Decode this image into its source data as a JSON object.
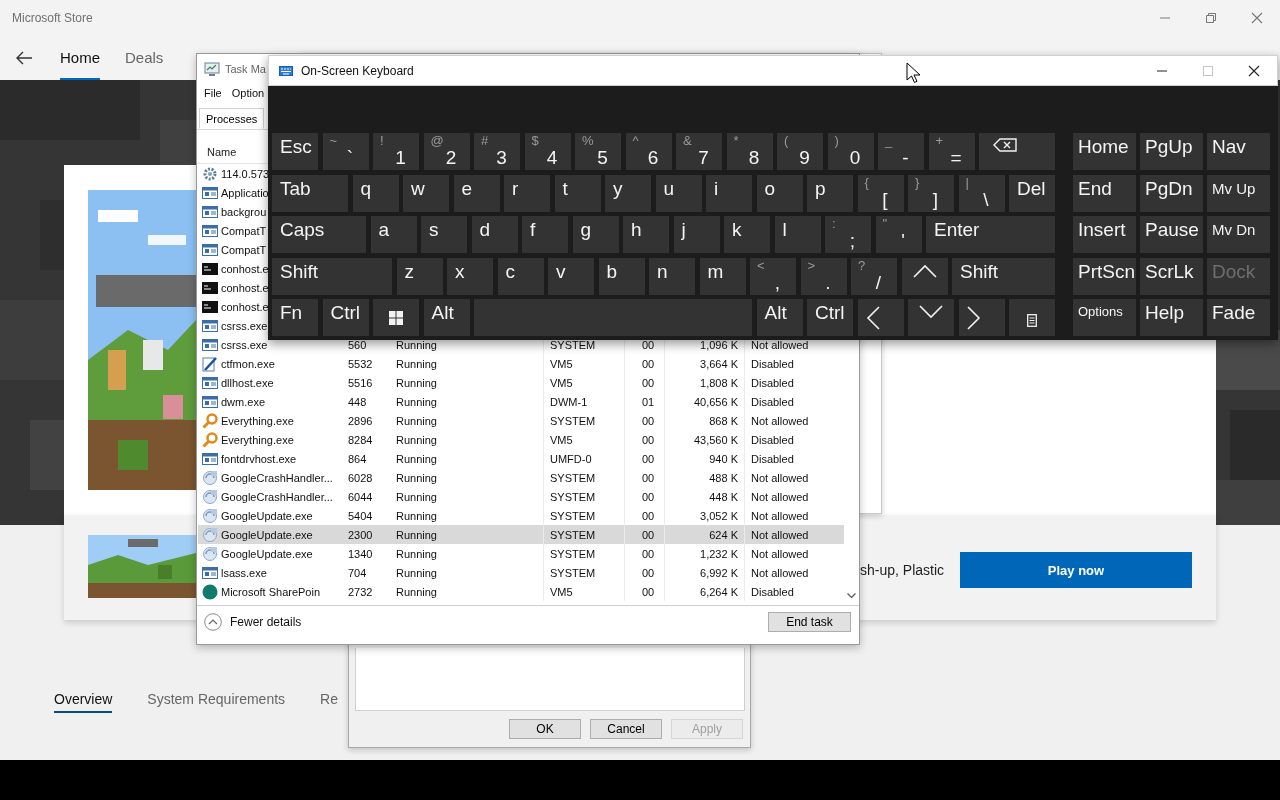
{
  "store": {
    "title": "Microsoft Store",
    "nav_tabs": [
      {
        "label": "Home",
        "selected": true
      },
      {
        "label": "Deals",
        "selected": false
      }
    ],
    "promo": {
      "text": "sh-up, Plastic",
      "button": "Play now"
    },
    "section_tabs": [
      {
        "label": "Overview",
        "selected": true
      },
      {
        "label": "System Requirements",
        "selected": false
      },
      {
        "label": "Re",
        "selected": false
      }
    ]
  },
  "properties_dialog": {
    "buttons": [
      {
        "label": "OK",
        "disabled": false
      },
      {
        "label": "Cancel",
        "disabled": false
      },
      {
        "label": "Apply",
        "disabled": true
      }
    ]
  },
  "task_manager": {
    "title": "Task Ma",
    "menu": [
      "File",
      "Option"
    ],
    "tabs": [
      {
        "label": "Processes",
        "selected": true
      }
    ],
    "name_column": "Name",
    "rows": [
      {
        "kind": "gear",
        "name": "114.0.573",
        "selected": false
      },
      {
        "kind": "window",
        "name": "Applicatio",
        "selected": false
      },
      {
        "kind": "window",
        "name": "backgrou",
        "selected": false
      },
      {
        "kind": "window",
        "name": "CompatT",
        "selected": false
      },
      {
        "kind": "window",
        "name": "CompatT",
        "selected": false
      },
      {
        "kind": "console",
        "name": "conhost.e",
        "selected": false
      },
      {
        "kind": "console",
        "name": "conhost.e",
        "selected": false
      },
      {
        "kind": "console",
        "name": "conhost.e",
        "selected": false
      },
      {
        "kind": "window",
        "name": "csrss.exe",
        "selected": false
      },
      {
        "kind": "window",
        "name": "csrss.exe",
        "pid": "560",
        "status": "Running",
        "user": "SYSTEM",
        "cpu": "00",
        "memory": "1,096 K",
        "uac": "Not allowed",
        "selected": false
      },
      {
        "kind": "pen",
        "name": "ctfmon.exe",
        "pid": "5532",
        "status": "Running",
        "user": "VM5",
        "cpu": "00",
        "memory": "3,664 K",
        "uac": "Disabled",
        "selected": false
      },
      {
        "kind": "window",
        "name": "dllhost.exe",
        "pid": "5516",
        "status": "Running",
        "user": "VM5",
        "cpu": "00",
        "memory": "1,808 K",
        "uac": "Disabled",
        "selected": false
      },
      {
        "kind": "window",
        "name": "dwm.exe",
        "pid": "448",
        "status": "Running",
        "user": "DWM-1",
        "cpu": "01",
        "memory": "40,656 K",
        "uac": "Disabled",
        "selected": false
      },
      {
        "kind": "magnifier",
        "name": "Everything.exe",
        "pid": "2896",
        "status": "Running",
        "user": "SYSTEM",
        "cpu": "00",
        "memory": "868 K",
        "uac": "Not allowed",
        "selected": false
      },
      {
        "kind": "magnifier",
        "name": "Everything.exe",
        "pid": "8284",
        "status": "Running",
        "user": "VM5",
        "cpu": "00",
        "memory": "43,560 K",
        "uac": "Disabled",
        "selected": false
      },
      {
        "kind": "window",
        "name": "fontdrvhost.exe",
        "pid": "864",
        "status": "Running",
        "user": "UMFD-0",
        "cpu": "00",
        "memory": "940 K",
        "uac": "Disabled",
        "selected": false
      },
      {
        "kind": "app",
        "name": "GoogleCrashHandler...",
        "pid": "6028",
        "status": "Running",
        "user": "SYSTEM",
        "cpu": "00",
        "memory": "488 K",
        "uac": "Not allowed",
        "selected": false
      },
      {
        "kind": "app",
        "name": "GoogleCrashHandler...",
        "pid": "6044",
        "status": "Running",
        "user": "SYSTEM",
        "cpu": "00",
        "memory": "448 K",
        "uac": "Not allowed",
        "selected": false
      },
      {
        "kind": "app",
        "name": "GoogleUpdate.exe",
        "pid": "5404",
        "status": "Running",
        "user": "SYSTEM",
        "cpu": "00",
        "memory": "3,052 K",
        "uac": "Not allowed",
        "selected": false
      },
      {
        "kind": "app",
        "name": "GoogleUpdate.exe",
        "pid": "2300",
        "status": "Running",
        "user": "SYSTEM",
        "cpu": "00",
        "memory": "624 K",
        "uac": "Not allowed",
        "selected": true
      },
      {
        "kind": "app",
        "name": "GoogleUpdate.exe",
        "pid": "1340",
        "status": "Running",
        "user": "SYSTEM",
        "cpu": "00",
        "memory": "1,232 K",
        "uac": "Not allowed",
        "selected": false
      },
      {
        "kind": "window",
        "name": "lsass.exe",
        "pid": "704",
        "status": "Running",
        "user": "SYSTEM",
        "cpu": "00",
        "memory": "6,992 K",
        "uac": "Not allowed",
        "selected": false
      },
      {
        "kind": "circle",
        "name": "Microsoft SharePoin",
        "pid": "2732",
        "status": "Running",
        "user": "VM5",
        "cpu": "00",
        "memory": "6,264 K",
        "uac": "Disabled",
        "selected": false
      }
    ],
    "footer": {
      "toggle": "Fewer details",
      "button": "End task"
    }
  },
  "keyboard": {
    "title": "On-Screen Keyboard",
    "rows": [
      [
        {
          "kind": "text",
          "label": "Esc"
        },
        {
          "kind": "char",
          "shift": "~",
          "label": "`"
        },
        {
          "kind": "char",
          "shift": "!",
          "label": "1"
        },
        {
          "kind": "char",
          "shift": "@",
          "label": "2"
        },
        {
          "kind": "char",
          "shift": "#",
          "label": "3"
        },
        {
          "kind": "char",
          "shift": "$",
          "label": "4"
        },
        {
          "kind": "char",
          "shift": "%",
          "label": "5"
        },
        {
          "kind": "char",
          "shift": "^",
          "label": "6"
        },
        {
          "kind": "char",
          "shift": "&",
          "label": "7"
        },
        {
          "kind": "char",
          "shift": "*",
          "label": "8"
        },
        {
          "kind": "char",
          "shift": "(",
          "label": "9"
        },
        {
          "kind": "char",
          "shift": ")",
          "label": "0"
        },
        {
          "kind": "char",
          "shift": "_",
          "label": "-"
        },
        {
          "kind": "char",
          "shift": "+",
          "label": "="
        },
        {
          "kind": "backspace"
        }
      ],
      [
        {
          "kind": "tab",
          "label": "Tab"
        },
        {
          "kind": "text",
          "label": "q"
        },
        {
          "kind": "text",
          "label": "w"
        },
        {
          "kind": "text",
          "label": "e"
        },
        {
          "kind": "text",
          "label": "r"
        },
        {
          "kind": "text",
          "label": "t"
        },
        {
          "kind": "text",
          "label": "y"
        },
        {
          "kind": "text",
          "label": "u"
        },
        {
          "kind": "text",
          "label": "i"
        },
        {
          "kind": "text",
          "label": "o"
        },
        {
          "kind": "text",
          "label": "p"
        },
        {
          "kind": "char",
          "shift": "{",
          "label": "["
        },
        {
          "kind": "char",
          "shift": "}",
          "label": "]"
        },
        {
          "kind": "char",
          "shift": "|",
          "label": "\\"
        },
        {
          "kind": "text",
          "label": "Del"
        }
      ],
      [
        {
          "kind": "caps",
          "label": "Caps"
        },
        {
          "kind": "text",
          "label": "a"
        },
        {
          "kind": "text",
          "label": "s"
        },
        {
          "kind": "text",
          "label": "d"
        },
        {
          "kind": "text",
          "label": "f"
        },
        {
          "kind": "text",
          "label": "g"
        },
        {
          "kind": "text",
          "label": "h"
        },
        {
          "kind": "text",
          "label": "j"
        },
        {
          "kind": "text",
          "label": "k"
        },
        {
          "kind": "text",
          "label": "l"
        },
        {
          "kind": "char",
          "shift": ":",
          "label": ";"
        },
        {
          "kind": "char",
          "shift": "\"",
          "label": "'"
        },
        {
          "kind": "enter",
          "label": "Enter"
        }
      ],
      [
        {
          "kind": "lshift",
          "label": "Shift"
        },
        {
          "kind": "text",
          "label": "z"
        },
        {
          "kind": "text",
          "label": "x"
        },
        {
          "kind": "text",
          "label": "c"
        },
        {
          "kind": "text",
          "label": "v"
        },
        {
          "kind": "text",
          "label": "b"
        },
        {
          "kind": "text",
          "label": "n"
        },
        {
          "kind": "text",
          "label": "m"
        },
        {
          "kind": "char",
          "shift": "<",
          "label": ","
        },
        {
          "kind": "char",
          "shift": ">",
          "label": "."
        },
        {
          "kind": "char",
          "shift": "?",
          "label": "/"
        },
        {
          "kind": "up"
        },
        {
          "kind": "rshift",
          "label": "Shift"
        }
      ],
      [
        {
          "kind": "text",
          "label": "Fn"
        },
        {
          "kind": "text",
          "label": "Ctrl"
        },
        {
          "kind": "windows"
        },
        {
          "kind": "text",
          "label": "Alt"
        },
        {
          "kind": "space"
        },
        {
          "kind": "text",
          "label": "Alt"
        },
        {
          "kind": "text",
          "label": "Ctrl"
        },
        {
          "kind": "left"
        },
        {
          "kind": "down"
        },
        {
          "kind": "right"
        },
        {
          "kind": "menu"
        }
      ]
    ],
    "nav": [
      {
        "kind": "text",
        "label": "Home",
        "disabled": false
      },
      {
        "kind": "text",
        "label": "PgUp",
        "disabled": false
      },
      {
        "kind": "text",
        "label": "Nav",
        "disabled": false
      },
      {
        "kind": "text",
        "label": "End",
        "disabled": false
      },
      {
        "kind": "text",
        "label": "PgDn",
        "disabled": false
      },
      {
        "kind": "small",
        "label": "Mv Up",
        "disabled": false
      },
      {
        "kind": "text",
        "label": "Insert",
        "disabled": false
      },
      {
        "kind": "text",
        "label": "Pause",
        "disabled": false
      },
      {
        "kind": "small",
        "label": "Mv Dn",
        "disabled": false
      },
      {
        "kind": "text",
        "label": "PrtScn",
        "disabled": false
      },
      {
        "kind": "text",
        "label": "ScrLk",
        "disabled": false
      },
      {
        "kind": "text",
        "label": "Dock",
        "disabled": true
      },
      {
        "kind": "tiny",
        "label": "Options",
        "disabled": false
      },
      {
        "kind": "text",
        "label": "Help",
        "disabled": false
      },
      {
        "kind": "text",
        "label": "Fade",
        "disabled": false
      }
    ]
  }
}
